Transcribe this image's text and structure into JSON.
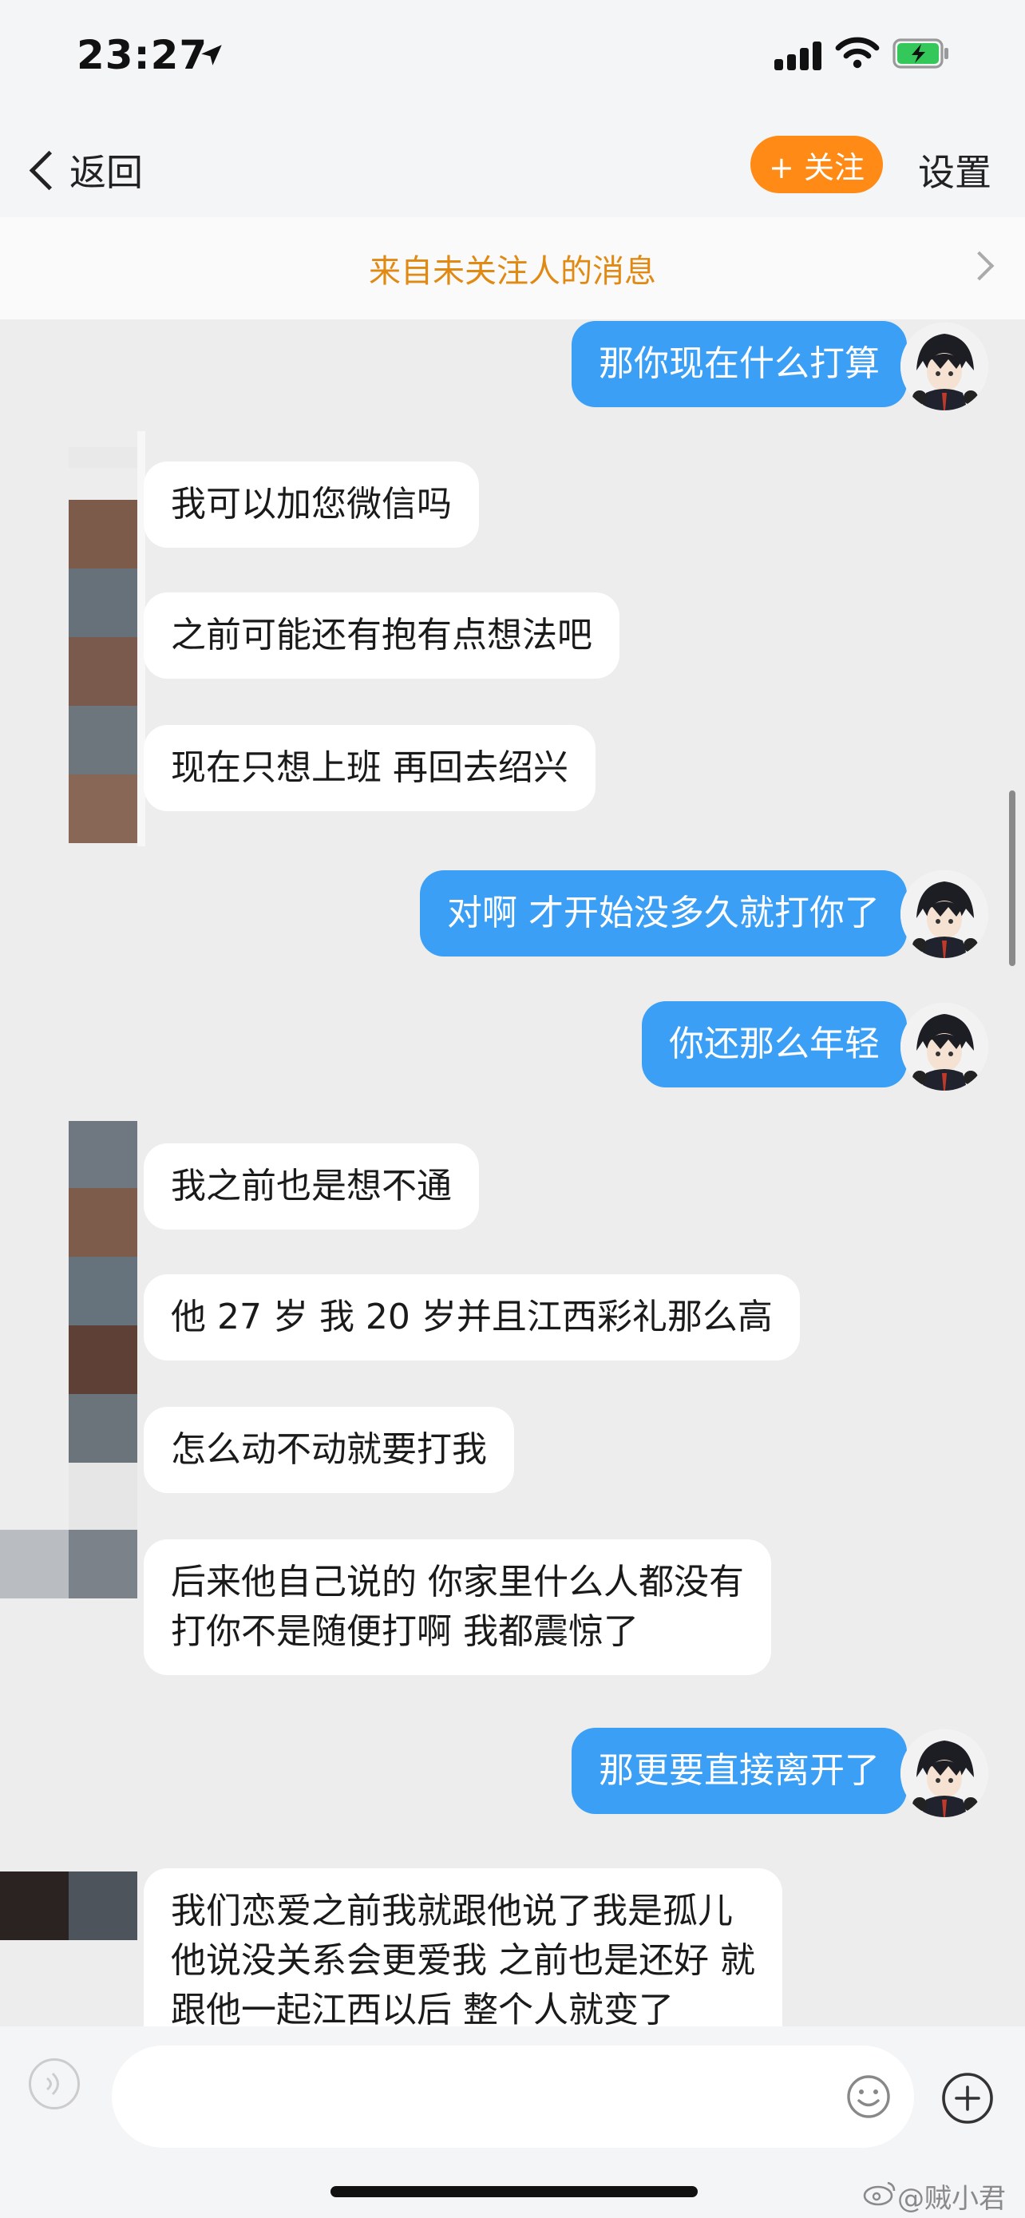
{
  "status_bar": {
    "time": "23:27"
  },
  "header": {
    "back_label": "返回",
    "follow_label": "+ 关注",
    "settings_label": "设置"
  },
  "notice": {
    "text": "来自未关注人的消息"
  },
  "messages": [
    {
      "from": "me",
      "text": "那你现在什么打算"
    },
    {
      "from": "other",
      "text": "我可以加您微信吗"
    },
    {
      "from": "other",
      "text": "之前可能还有抱有点想法吧"
    },
    {
      "from": "other",
      "text": "现在只想上班 再回去绍兴"
    },
    {
      "from": "me",
      "text": "对啊 才开始没多久就打你了"
    },
    {
      "from": "me",
      "text": "你还那么年轻"
    },
    {
      "from": "other",
      "text": "我之前也是想不通"
    },
    {
      "from": "other",
      "text": "他 27 岁 我 20 岁并且江西彩礼那么高"
    },
    {
      "from": "other",
      "text": "怎么动不动就要打我"
    },
    {
      "from": "other",
      "lines": [
        "后来他自己说的 你家里什么人都没有",
        "打你不是随便打啊 我都震惊了"
      ]
    },
    {
      "from": "me",
      "text": "那更要直接离开了"
    },
    {
      "from": "other",
      "lines": [
        "我们恋爱之前我就跟他说了我是孤儿",
        "他说没关系会更爱我 之前也是还好 就",
        "跟他一起江西以后 整个人就变了"
      ]
    }
  ],
  "input": {
    "placeholder": ""
  },
  "watermark": {
    "text": "@贼小君"
  },
  "colors": {
    "sent_bubble": "#3a9ff5",
    "follow_button": "#ff8a15",
    "notice_text": "#e08a14"
  },
  "icons": [
    "location-arrow-icon",
    "signal-icon",
    "wifi-icon",
    "battery-charging-icon",
    "back-chevron-icon",
    "notice-chevron-icon",
    "voice-icon",
    "emoji-icon",
    "plus-icon",
    "weibo-icon"
  ]
}
